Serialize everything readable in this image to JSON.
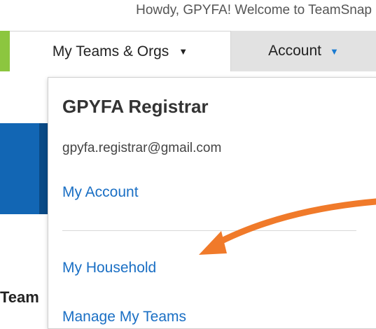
{
  "header": {
    "greeting": "Howdy, GPYFA! Welcome to TeamSnap"
  },
  "nav": {
    "teams_label": "My Teams & Orgs",
    "teams_caret": "▼",
    "account_label": "Account",
    "account_caret": "▼"
  },
  "sidebar": {
    "team_label": "Team"
  },
  "account_menu": {
    "user_name": "GPYFA Registrar",
    "user_email": "gpyfa.registrar@gmail.com",
    "items": [
      {
        "label": "My Account"
      },
      {
        "label": "My Household"
      },
      {
        "label": "Manage My Teams"
      }
    ]
  },
  "colors": {
    "link": "#1a6fc4",
    "accent_green": "#8cc63f",
    "annotation_arrow": "#f07a2a"
  }
}
